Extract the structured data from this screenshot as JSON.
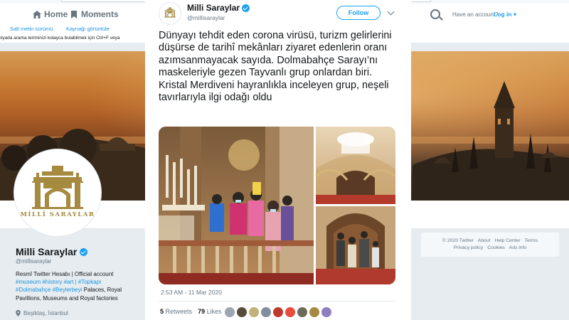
{
  "nav": {
    "home_label": "Home",
    "moments_label": "Moments",
    "have_account": "Have an account?",
    "login_label": "Log in ▾"
  },
  "subbar": {
    "link1": "Salt metin sürümü",
    "link2": "Kaynağı görüntüle",
    "hint": "ılyada arama teriminizi kolayca bulabilmek için Ctrl+F veya"
  },
  "profile": {
    "name": "Milli Saraylar",
    "handle": "@millisaraylar",
    "bio_line1": "Resmî Twitter Hesabı | Official account",
    "bio_tags": "#museum #history #art | #Topkapı",
    "bio_line3_tags": "#Dolmabahçe #Beylerbeyi",
    "bio_line3_rest": " Palaces, Royal",
    "bio_line4": "Pavillions, Museums and Royal factories",
    "location": "Beşiktaş, İstanbul",
    "avatar_word": "MİLLİ SARAYLAR"
  },
  "footer": {
    "copyright": "© 2020 Twitter",
    "about": "About",
    "help": "Help Center",
    "terms": "Terms",
    "privacy": "Privacy policy",
    "cookies": "Cookies",
    "ads": "Ads info"
  },
  "tweet": {
    "author_name": "Milli Saraylar",
    "author_handle": "@millisaraylar",
    "follow_label": "Follow",
    "text": "Dünyayı tehdit eden corona virüsü, turizm gelirlerini düşürse de tarihî mekânları ziyaret edenlerin oranı azımsanmayacak sayıda. Dolmabahçe Sarayı’nı maskeleriyle gezen Tayvanlı grup onlardan biri. Kristal Merdiveni hayranlıkla inceleyen grup, neşeli tavırlarıyla ilgi odağı oldu",
    "timestamp": "2:53 AM - 11 Mar 2020",
    "retweets_count": "5",
    "retweets_label": "Retweets",
    "likes_count": "79",
    "likes_label": "Likes"
  },
  "colors": {
    "twitter_blue": "#1da1f2",
    "link_blue": "#1b95e0",
    "gold": "#a58a3f"
  },
  "icons": [
    "home-icon",
    "moments-icon",
    "search-icon",
    "verified-icon",
    "chevron-down-icon",
    "location-pin-icon"
  ]
}
